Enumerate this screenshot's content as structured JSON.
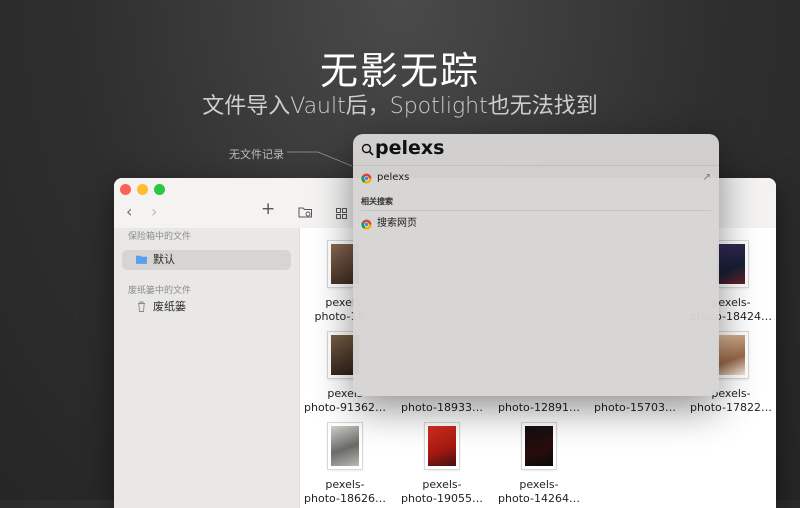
{
  "headline": "无影无踪",
  "subline": "文件导入Vault后，Spotlight也无法找到",
  "callout": "无文件记录",
  "window": {
    "toolbar_icons": [
      "back-icon",
      "forward-icon",
      "add-icon",
      "new-folder-icon",
      "grid-view-icon"
    ],
    "nav_back": "‹",
    "nav_forward": "›",
    "add_glyph": "+",
    "sidebar": {
      "section_vault": "保险箱中的文件",
      "item_default": "默认",
      "section_trash": "废纸篓中的文件",
      "item_trash": "废纸篓"
    },
    "files": [
      {
        "line1": "pexels-",
        "line2": "photo-18…",
        "color": "#6b4a3a"
      },
      {
        "line1": "pexels-",
        "line2": "photo-18424…",
        "color": "#20304a"
      },
      {
        "line1": "pexels",
        "line2": "photo-91362…",
        "color": "#5a4636"
      },
      {
        "line1": "",
        "line2": "photo-18933…",
        "color": "#444444"
      },
      {
        "line1": "",
        "line2": "photo-12891…",
        "color": "#444444"
      },
      {
        "line1": "",
        "line2": "photo-15703…",
        "color": "#444444"
      },
      {
        "line1": "pexels-",
        "line2": "photo-17822…",
        "color": "#b48a6a"
      },
      {
        "line1": "pexels-",
        "line2": "photo-18626…",
        "color": "#8c8c8c"
      },
      {
        "line1": "pexels-",
        "line2": "photo-19055…",
        "color": "#c0281e"
      },
      {
        "line1": "pexels-",
        "line2": "photo-14264…",
        "color": "#1a1a1a"
      }
    ]
  },
  "spotlight": {
    "query": "pelexs",
    "top_hit": "pelexs",
    "top_hit_arrow": "↗",
    "section_related": "相关搜索",
    "search_web": "搜索网页"
  }
}
